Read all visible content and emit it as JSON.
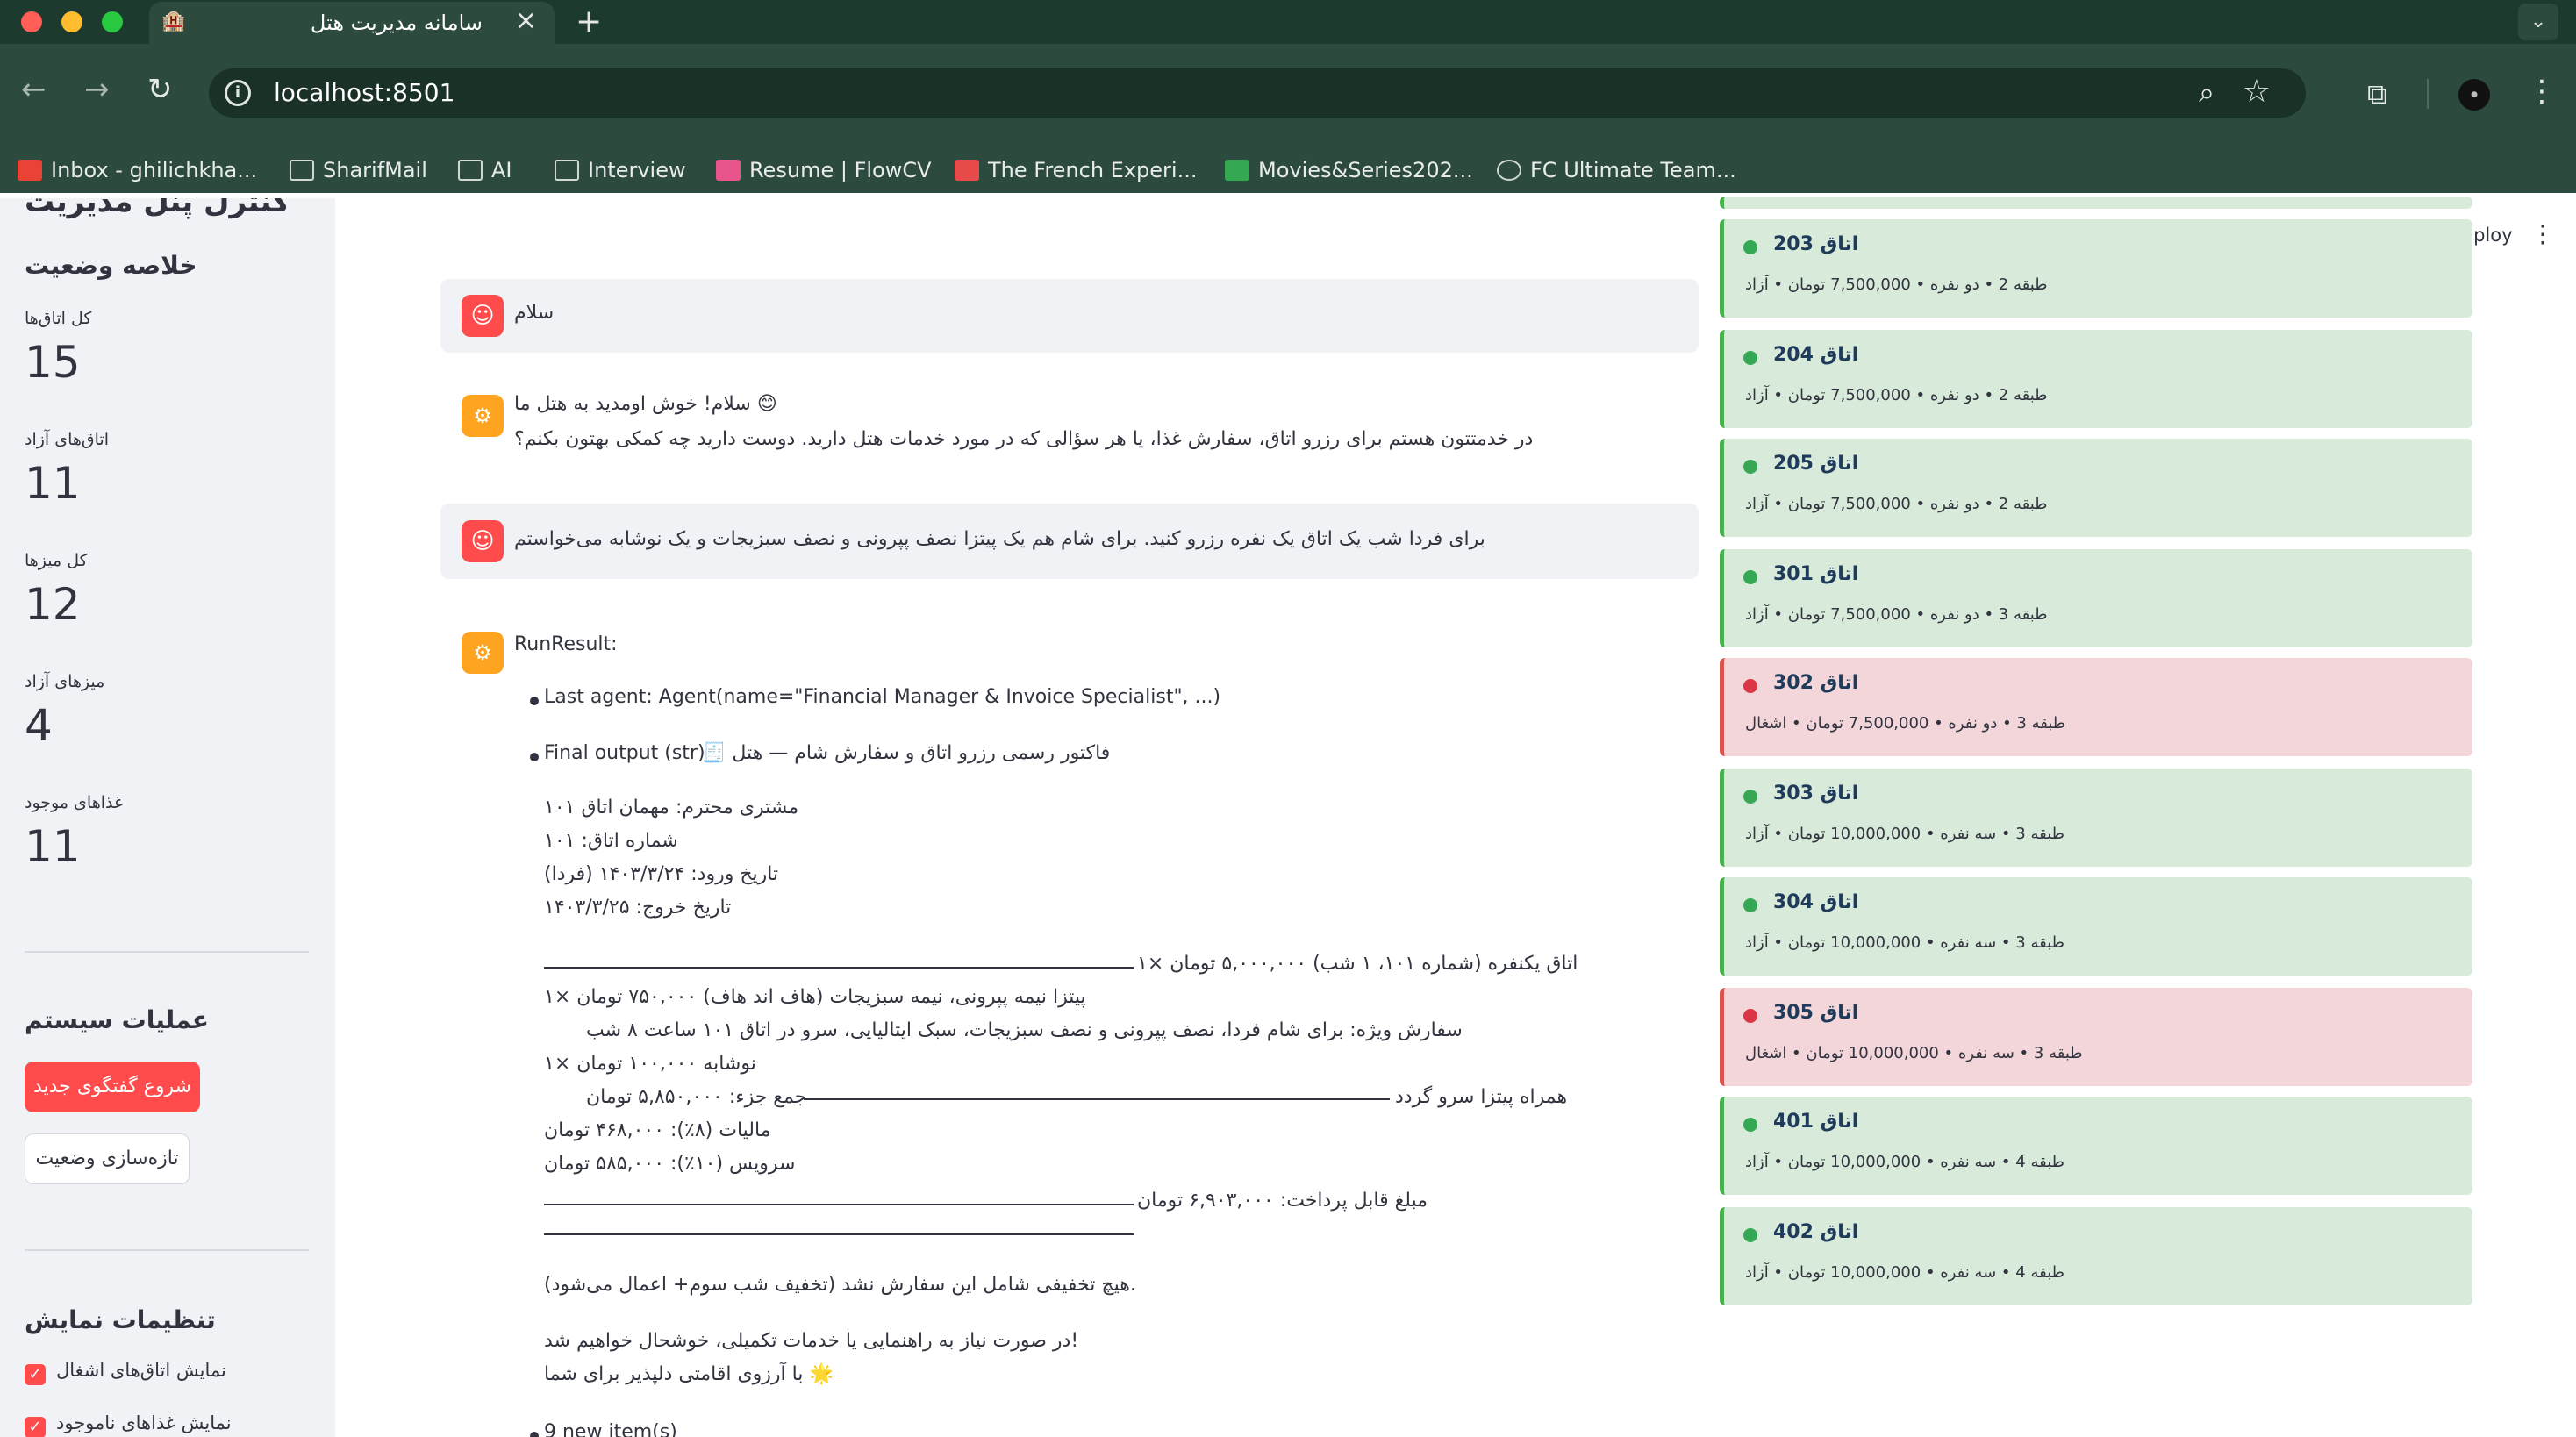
{
  "browser": {
    "tab_title": "سامانه مدیریت هتل",
    "url": "localhost:8501",
    "bookmarks": [
      {
        "label": "Inbox - ghilichkha...",
        "icon": "gmail-icon",
        "color": "#ea4335"
      },
      {
        "label": "SharifMail",
        "icon": "mail-icon",
        "color": "#cfd8d4"
      },
      {
        "label": "AI",
        "icon": "folder-icon",
        "color": "#cfd8d4"
      },
      {
        "label": "Interview",
        "icon": "folder-icon",
        "color": "#cfd8d4"
      },
      {
        "label": "Resume | FlowCV",
        "icon": "flowcv-icon",
        "color": "#e8558c"
      },
      {
        "label": "The French Experi...",
        "icon": "star-badge-icon",
        "color": "#e84a4a"
      },
      {
        "label": "Movies&Series202...",
        "icon": "sheets-icon",
        "color": "#34a853"
      },
      {
        "label": "FC Ultimate Team...",
        "icon": "globe-icon",
        "color": "#cfd8d4"
      }
    ]
  },
  "sidebar": {
    "panel_title": "کنترل پنل مدیریت",
    "summary_title": "خلاصه وضعیت",
    "metrics": [
      {
        "label": "کل اتاق‌ها",
        "value": "15"
      },
      {
        "label": "اتاق‌های آزاد",
        "value": "11"
      },
      {
        "label": "کل میزها",
        "value": "12"
      },
      {
        "label": "میزهای آزاد",
        "value": "4"
      },
      {
        "label": "غذاهای موجود",
        "value": "11"
      }
    ],
    "ops_title": "عملیات سیستم",
    "new_chat_button": "شروع گفتگوی جدید",
    "refresh_button": "تازه‌سازی وضعیت",
    "display_title": "تنظیمات نمایش",
    "checkboxes": [
      {
        "label": "نمایش اتاق‌های اشغال",
        "checked": true
      },
      {
        "label": "نمایش غذاهای ناموجود",
        "checked": true
      }
    ]
  },
  "header": {
    "deploy": "Deploy"
  },
  "chat": {
    "msg1_user": "سلام",
    "msg2_bot_line1": "😊 سلام! خوش اومدید به هتل ما",
    "msg2_bot_line2": "در خدمتتون هستم برای رزرو اتاق، سفارش غذا، یا هر سؤالی که در مورد خدمات هتل دارید. دوست دارید چه کمکی بهتون بکنم؟",
    "msg3_user": "برای فردا شب یک اتاق یک نفره رزرو کنید. برای شام هم یک پیتزا نصف پپرونی و نصف سبزیجات و یک نوشابه می‌خواستم",
    "run_result": "RunResult:",
    "last_agent": "Last agent: Agent(name=\"Financial Manager & Invoice Specialist\", ...)",
    "final_output_prefix": "Final output (str):",
    "final_output_title": "فاکتور رسمی رزرو اتاق و سفارش شام — هتل 🧾",
    "invoice_lines": [
      "مشتری محترم: مهمان اتاق ۱۰۱",
      "شماره اتاق: ۱۰۱",
      "تاریخ ورود: ۱۴۰۳/۳/۲۴ (فردا)",
      "تاریخ خروج: ۱۴۰۳/۳/۲۵"
    ],
    "room_line": "اتاق یکنفره (شماره ۱۰۱، ۱ شب) ۵,۰۰۰,۰۰۰ تومان ×۱",
    "pizza_line": "پیتزا نیمه پپرونی، نیمه سبزیجات (هاف اند هاف) ۷۵۰,۰۰۰ تومان ×۱",
    "special_order": "سفارش ویژه: برای شام فردا، نصف پپرونی و نصف سبزیجات، سبک ایتالیایی، سرو در اتاق ۱۰۱ ساعت ۸ شب",
    "drink_line": "نوشابه ۱۰۰,۰۰۰ تومان ×۱",
    "serve_note": "همراه پیتزا سرو گردد",
    "subtotal": "جمع جزء: ۵,۸۵۰,۰۰۰ تومان",
    "tax": "مالیات (۸٪): ۴۶۸,۰۰۰ تومان",
    "service": "سرویس (۱۰٪): ۵۸۵,۰۰۰ تومان",
    "total": "مبلغ قابل پرداخت: ۶,۹۰۳,۰۰۰ تومان",
    "discount_note": ".هیچ تخفیفی شامل این سفارش نشد (تخفیف شب سوم+ اعمال می‌شود)",
    "help_note": "!در صورت نیاز به راهنمایی یا خدمات تکمیلی، خوشحال خواهیم شد",
    "wish_note": "🌟 با آرزوی اقامتی دلپذیر برای شما",
    "new_items": "9 new item(s)"
  },
  "rooms": [
    {
      "title": "اتاق 203",
      "info": "طبقه 2 • دو نفره • 7,500,000 تومان • آزاد",
      "status": "free"
    },
    {
      "title": "اتاق 204",
      "info": "طبقه 2 • دو نفره • 7,500,000 تومان • آزاد",
      "status": "free"
    },
    {
      "title": "اتاق 205",
      "info": "طبقه 2 • دو نفره • 7,500,000 تومان • آزاد",
      "status": "free"
    },
    {
      "title": "اتاق 301",
      "info": "طبقه 3 • دو نفره • 7,500,000 تومان • آزاد",
      "status": "free"
    },
    {
      "title": "اتاق 302",
      "info": "طبقه 3 • دو نفره • 7,500,000 تومان • اشغال",
      "status": "busy"
    },
    {
      "title": "اتاق 303",
      "info": "طبقه 3 • سه نفره • 10,000,000 تومان • آزاد",
      "status": "free"
    },
    {
      "title": "اتاق 304",
      "info": "طبقه 3 • سه نفره • 10,000,000 تومان • آزاد",
      "status": "free"
    },
    {
      "title": "اتاق 305",
      "info": "طبقه 3 • سه نفره • 10,000,000 تومان • اشغال",
      "status": "busy"
    },
    {
      "title": "اتاق 401",
      "info": "طبقه 4 • سه نفره • 10,000,000 تومان • آزاد",
      "status": "free"
    },
    {
      "title": "اتاق 402",
      "info": "طبقه 4 • سه نفره • 10,000,000 تومان • آزاد",
      "status": "free"
    }
  ]
}
